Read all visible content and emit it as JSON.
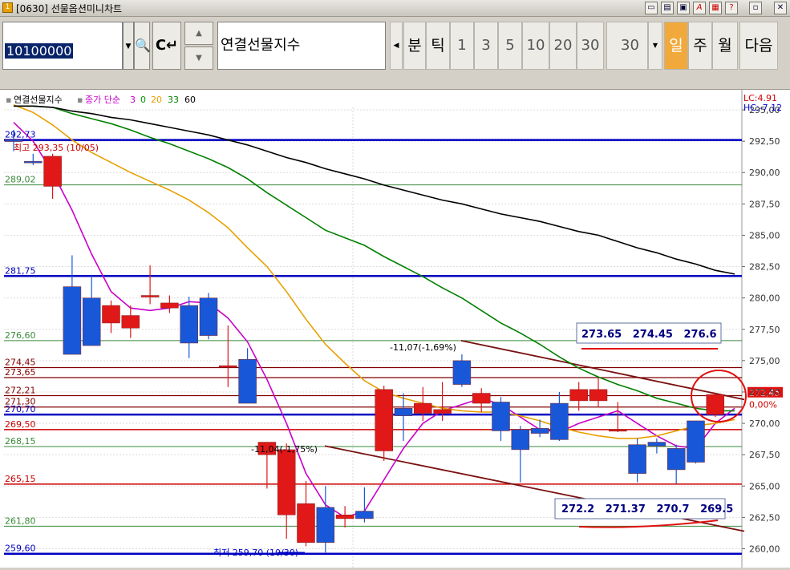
{
  "window": {
    "title": "[0630] 선물옵션미니차트",
    "buttons": [
      "win-icon-1",
      "win-icon-2",
      "win-icon-3",
      "win-icon-4",
      "win-icon-5",
      "?",
      "x"
    ]
  },
  "toolbar": {
    "code": "10100000",
    "instrument": "연결선물지수",
    "period_buttons": [
      "분",
      "틱",
      "1",
      "3",
      "5",
      "10",
      "20",
      "30"
    ],
    "count": "30",
    "timeframes": [
      "일",
      "주",
      "월"
    ],
    "active_timeframe": "일",
    "next_label": "다음"
  },
  "chart_data": {
    "type": "candlestick",
    "title": "연결선물지수",
    "legend": {
      "label": "종가 단순",
      "periods": [
        "3",
        "0",
        "20",
        "33",
        "60"
      ],
      "colors": [
        "#c800c8",
        "#009000",
        "#e8a000",
        "#008000",
        "#000000"
      ]
    },
    "top_right": [
      "LC:4.91",
      "HC:-7.12"
    ],
    "ylim": [
      259.2,
      296.6
    ],
    "yticks": [
      "295,00",
      "292,50",
      "290,00",
      "287,50",
      "285,00",
      "282,50",
      "280,00",
      "277,50",
      "275,00",
      "272,50",
      "270,00",
      "267,50",
      "265,00",
      "262,50",
      "260,00"
    ],
    "ytick_values": [
      295,
      292.5,
      290,
      287.5,
      285,
      282.5,
      280,
      277.5,
      275,
      272.5,
      270,
      267.5,
      265,
      262.5,
      260
    ],
    "current_price": {
      "label": "272,45",
      "value": 272.45,
      "change": "0,00%"
    },
    "horizontal_lines": [
      {
        "value": 292.6,
        "label": "292,73",
        "color": "#0000c0",
        "width": 2.5
      },
      {
        "value": 289.02,
        "label": "289,02",
        "color": "#3a8a3a",
        "width": 1
      },
      {
        "value": 281.75,
        "label": "281,75",
        "color": "#0000c0",
        "width": 2.5
      },
      {
        "value": 276.6,
        "label": "276,60",
        "color": "#3a8a3a",
        "width": 1
      },
      {
        "value": 274.45,
        "label": "274,45",
        "color": "#800000",
        "width": 1.2
      },
      {
        "value": 273.65,
        "label": "273,65",
        "color": "#800000",
        "width": 1.2
      },
      {
        "value": 272.21,
        "label": "272,21",
        "color": "#800000",
        "width": 1.2
      },
      {
        "value": 271.3,
        "label": "271,30",
        "color": "#800000",
        "width": 1.2
      },
      {
        "value": 270.7,
        "label": "270,70",
        "color": "#0000c0",
        "width": 2.5
      },
      {
        "value": 269.5,
        "label": "269,50",
        "color": "#cc0000",
        "width": 1.5
      },
      {
        "value": 268.15,
        "label": "268,15",
        "color": "#3a8a3a",
        "width": 1
      },
      {
        "value": 265.15,
        "label": "265,15",
        "color": "#cc0000",
        "width": 1.5
      },
      {
        "value": 261.8,
        "label": "261,80",
        "color": "#3a8a3a",
        "width": 1
      },
      {
        "value": 259.6,
        "label": "259,60",
        "color": "#0000c0",
        "width": 2.5
      }
    ],
    "candles": [
      {
        "o": 292.6,
        "h": 293.4,
        "l": 291.7,
        "c": 292.5
      },
      {
        "o": 290.9,
        "h": 291.5,
        "l": 290.6,
        "c": 290.8
      },
      {
        "o": 288.9,
        "h": 291.5,
        "l": 287.9,
        "c": 291.3
      },
      {
        "o": 280.9,
        "h": 283.4,
        "l": 275.6,
        "c": 275.5
      },
      {
        "o": 280.0,
        "h": 281.8,
        "l": 276.8,
        "c": 276.2
      },
      {
        "o": 278.0,
        "h": 279.8,
        "l": 277.2,
        "c": 279.4
      },
      {
        "o": 277.6,
        "h": 279.4,
        "l": 276.8,
        "c": 278.6
      },
      {
        "o": 280.1,
        "h": 282.6,
        "l": 279.5,
        "c": 280.2
      },
      {
        "o": 279.2,
        "h": 280.2,
        "l": 278.8,
        "c": 279.6
      },
      {
        "o": 279.4,
        "h": 280.1,
        "l": 275.2,
        "c": 276.4
      },
      {
        "o": 280.0,
        "h": 280.4,
        "l": 276.7,
        "c": 277.0
      },
      {
        "o": 274.6,
        "h": 277.8,
        "l": 272.9,
        "c": 274.6
      },
      {
        "o": 275.1,
        "h": 276.0,
        "l": 271.9,
        "c": 271.6
      },
      {
        "o": 267.5,
        "h": 268.1,
        "l": 264.8,
        "c": 268.5
      },
      {
        "o": 262.7,
        "h": 268.4,
        "l": 260.8,
        "c": 267.9
      },
      {
        "o": 260.5,
        "h": 265.4,
        "l": 260.2,
        "c": 263.6
      },
      {
        "o": 263.3,
        "h": 265.0,
        "l": 259.7,
        "c": 260.5
      },
      {
        "o": 262.4,
        "h": 263.4,
        "l": 261.7,
        "c": 262.7
      },
      {
        "o": 263.0,
        "h": 264.9,
        "l": 262.1,
        "c": 262.4
      },
      {
        "o": 267.8,
        "h": 273.0,
        "l": 267.0,
        "c": 272.7
      },
      {
        "o": 271.2,
        "h": 272.4,
        "l": 268.6,
        "c": 270.6
      },
      {
        "o": 270.8,
        "h": 272.9,
        "l": 270.2,
        "c": 271.6
      },
      {
        "o": 270.8,
        "h": 273.3,
        "l": 270.2,
        "c": 271.1
      },
      {
        "o": 275.0,
        "h": 275.5,
        "l": 272.9,
        "c": 273.1
      },
      {
        "o": 271.6,
        "h": 272.8,
        "l": 270.9,
        "c": 272.4
      },
      {
        "o": 271.7,
        "h": 272.1,
        "l": 268.6,
        "c": 269.4
      },
      {
        "o": 269.5,
        "h": 269.8,
        "l": 265.3,
        "c": 267.9
      },
      {
        "o": 269.6,
        "h": 270.3,
        "l": 268.9,
        "c": 269.2
      },
      {
        "o": 271.6,
        "h": 272.5,
        "l": 268.6,
        "c": 268.7
      },
      {
        "o": 271.8,
        "h": 273.3,
        "l": 271.0,
        "c": 272.7
      },
      {
        "o": 271.8,
        "h": 273.6,
        "l": 271.3,
        "c": 272.7
      },
      {
        "o": 269.4,
        "h": 271.7,
        "l": 269.3,
        "c": 269.5
      },
      {
        "o": 268.3,
        "h": 268.8,
        "l": 265.3,
        "c": 266.0
      },
      {
        "o": 268.5,
        "h": 268.8,
        "l": 267.6,
        "c": 268.2
      },
      {
        "o": 268.0,
        "h": 268.3,
        "l": 265.2,
        "c": 266.3
      },
      {
        "o": 270.2,
        "h": 270.2,
        "l": 266.8,
        "c": 266.9
      },
      {
        "o": 270.7,
        "h": 272.4,
        "l": 270.5,
        "c": 272.3
      }
    ],
    "ma_lines": [
      {
        "name": "3",
        "color": "#c800c8",
        "values": [
          294.0,
          292.5,
          290.0,
          287.0,
          283.5,
          280.5,
          279.2,
          279.0,
          279.2,
          279.7,
          279.6,
          278.4,
          276.5,
          273.5,
          270.0,
          266.0,
          263.5,
          262.5,
          263.0,
          265.5,
          268.0,
          270.0,
          271.0,
          271.5,
          272.0,
          271.5,
          270.5,
          269.5,
          269.3,
          270.0,
          270.5,
          271.0,
          270.0,
          269.0,
          268.2,
          268.0,
          270.0,
          271.2
        ]
      },
      {
        "name": "20",
        "color": "#e8a000",
        "values": [
          295.4,
          294.8,
          293.8,
          292.6,
          291.6,
          290.8,
          290.0,
          289.3,
          288.6,
          287.8,
          286.8,
          285.6,
          284.0,
          282.5,
          280.5,
          278.3,
          276.3,
          274.8,
          273.4,
          272.5,
          272.0,
          271.6,
          271.2,
          271.0,
          270.9,
          270.9,
          270.6,
          270.2,
          269.7,
          269.3,
          269.0,
          268.8,
          268.8,
          269.0,
          269.4,
          269.8,
          270.0,
          270.3
        ]
      },
      {
        "name": "33",
        "color": "#008000",
        "values": [
          295.3,
          295.3,
          295.2,
          294.7,
          294.3,
          293.9,
          293.4,
          292.8,
          292.3,
          291.7,
          291.1,
          290.4,
          289.5,
          288.4,
          287.4,
          286.4,
          285.4,
          284.8,
          284.2,
          283.3,
          282.5,
          281.7,
          280.8,
          280.0,
          279.0,
          278.0,
          277.2,
          276.3,
          275.3,
          274.4,
          273.7,
          273.1,
          272.6,
          272.0,
          271.6,
          271.2,
          271.0,
          271.0
        ]
      },
      {
        "name": "60",
        "color": "#000000",
        "values": [
          295.3,
          295.3,
          295.2,
          294.9,
          294.7,
          294.4,
          294.2,
          293.9,
          293.6,
          293.3,
          293.0,
          292.6,
          292.2,
          291.7,
          291.2,
          290.8,
          290.3,
          289.9,
          289.5,
          289.0,
          288.6,
          288.2,
          287.8,
          287.5,
          287.1,
          286.7,
          286.4,
          286.1,
          285.7,
          285.3,
          285.0,
          284.5,
          284.0,
          283.6,
          283.1,
          282.7,
          282.2,
          281.9
        ]
      }
    ],
    "annotations": {
      "high": {
        "label": "최고 293,35 (10/05)",
        "value": 293.35
      },
      "low": {
        "label": "최저 259,70 (10/30)",
        "value": 259.7
      },
      "trend1": {
        "label": "-11,07(-1,69%)",
        "value": 276.6
      },
      "trend2": {
        "label": "-11,04(-1,75%)",
        "value": 268.2
      }
    },
    "notes": [
      {
        "text": "273.65   274.45   276.6"
      },
      {
        "text": "272.2   271.37   270.7   269.5"
      }
    ]
  }
}
